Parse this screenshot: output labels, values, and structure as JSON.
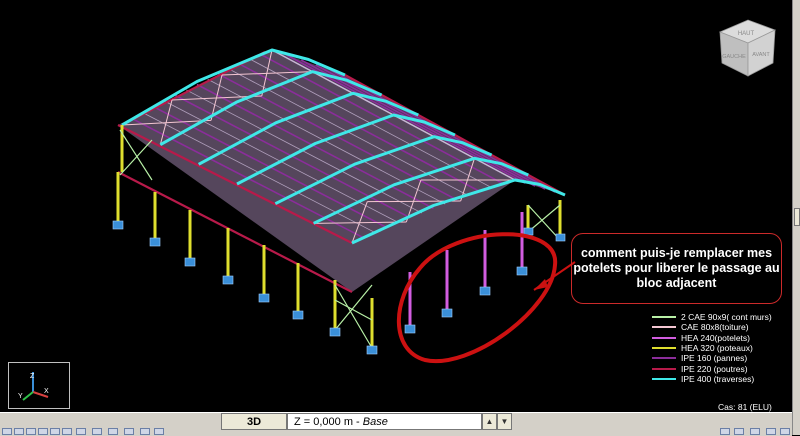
{
  "legend": {
    "items": [
      {
        "label": "2 CAE 90x9( cont murs)",
        "color": "#b8f0a6"
      },
      {
        "label": "CAE 80x8(toiture)",
        "color": "#f4c6d2"
      },
      {
        "label": "HEA 240(potelets)",
        "color": "#d25de0"
      },
      {
        "label": "HEA 320 (poteaux)",
        "color": "#dfdf2e"
      },
      {
        "label": "IPE 160 (pannes)",
        "color": "#8b2d9b"
      },
      {
        "label": "IPE 220 (poutres)",
        "color": "#b81a4a"
      },
      {
        "label": "IPE 400 (traverses)",
        "color": "#3fe8e8"
      }
    ]
  },
  "case_label": "Cas: 81 (ELU)",
  "callout": {
    "text": "comment puis-je remplacer mes potelets pour liberer le passage au bloc adjacent"
  },
  "viewcube": {
    "faces": [
      "HAUT",
      "GAUCHE",
      "AVANT"
    ]
  },
  "axes": {
    "x": "X",
    "y": "Y",
    "z": "Z"
  },
  "bottom_bar": {
    "view_mode": "3D",
    "level_prefix": "Z = 0,000 m - ",
    "level_name": "Base"
  },
  "colors": {
    "background": "#000000",
    "columns": "#dfdf2e",
    "rafters": "#3fe8e8",
    "purlins": "#8b2d9b",
    "beams": "#b81a4a",
    "bracing": "#f4c6d2",
    "potelets": "#d25de0",
    "annotation_red": "#cc1111",
    "supports": "#3a8fd8"
  }
}
